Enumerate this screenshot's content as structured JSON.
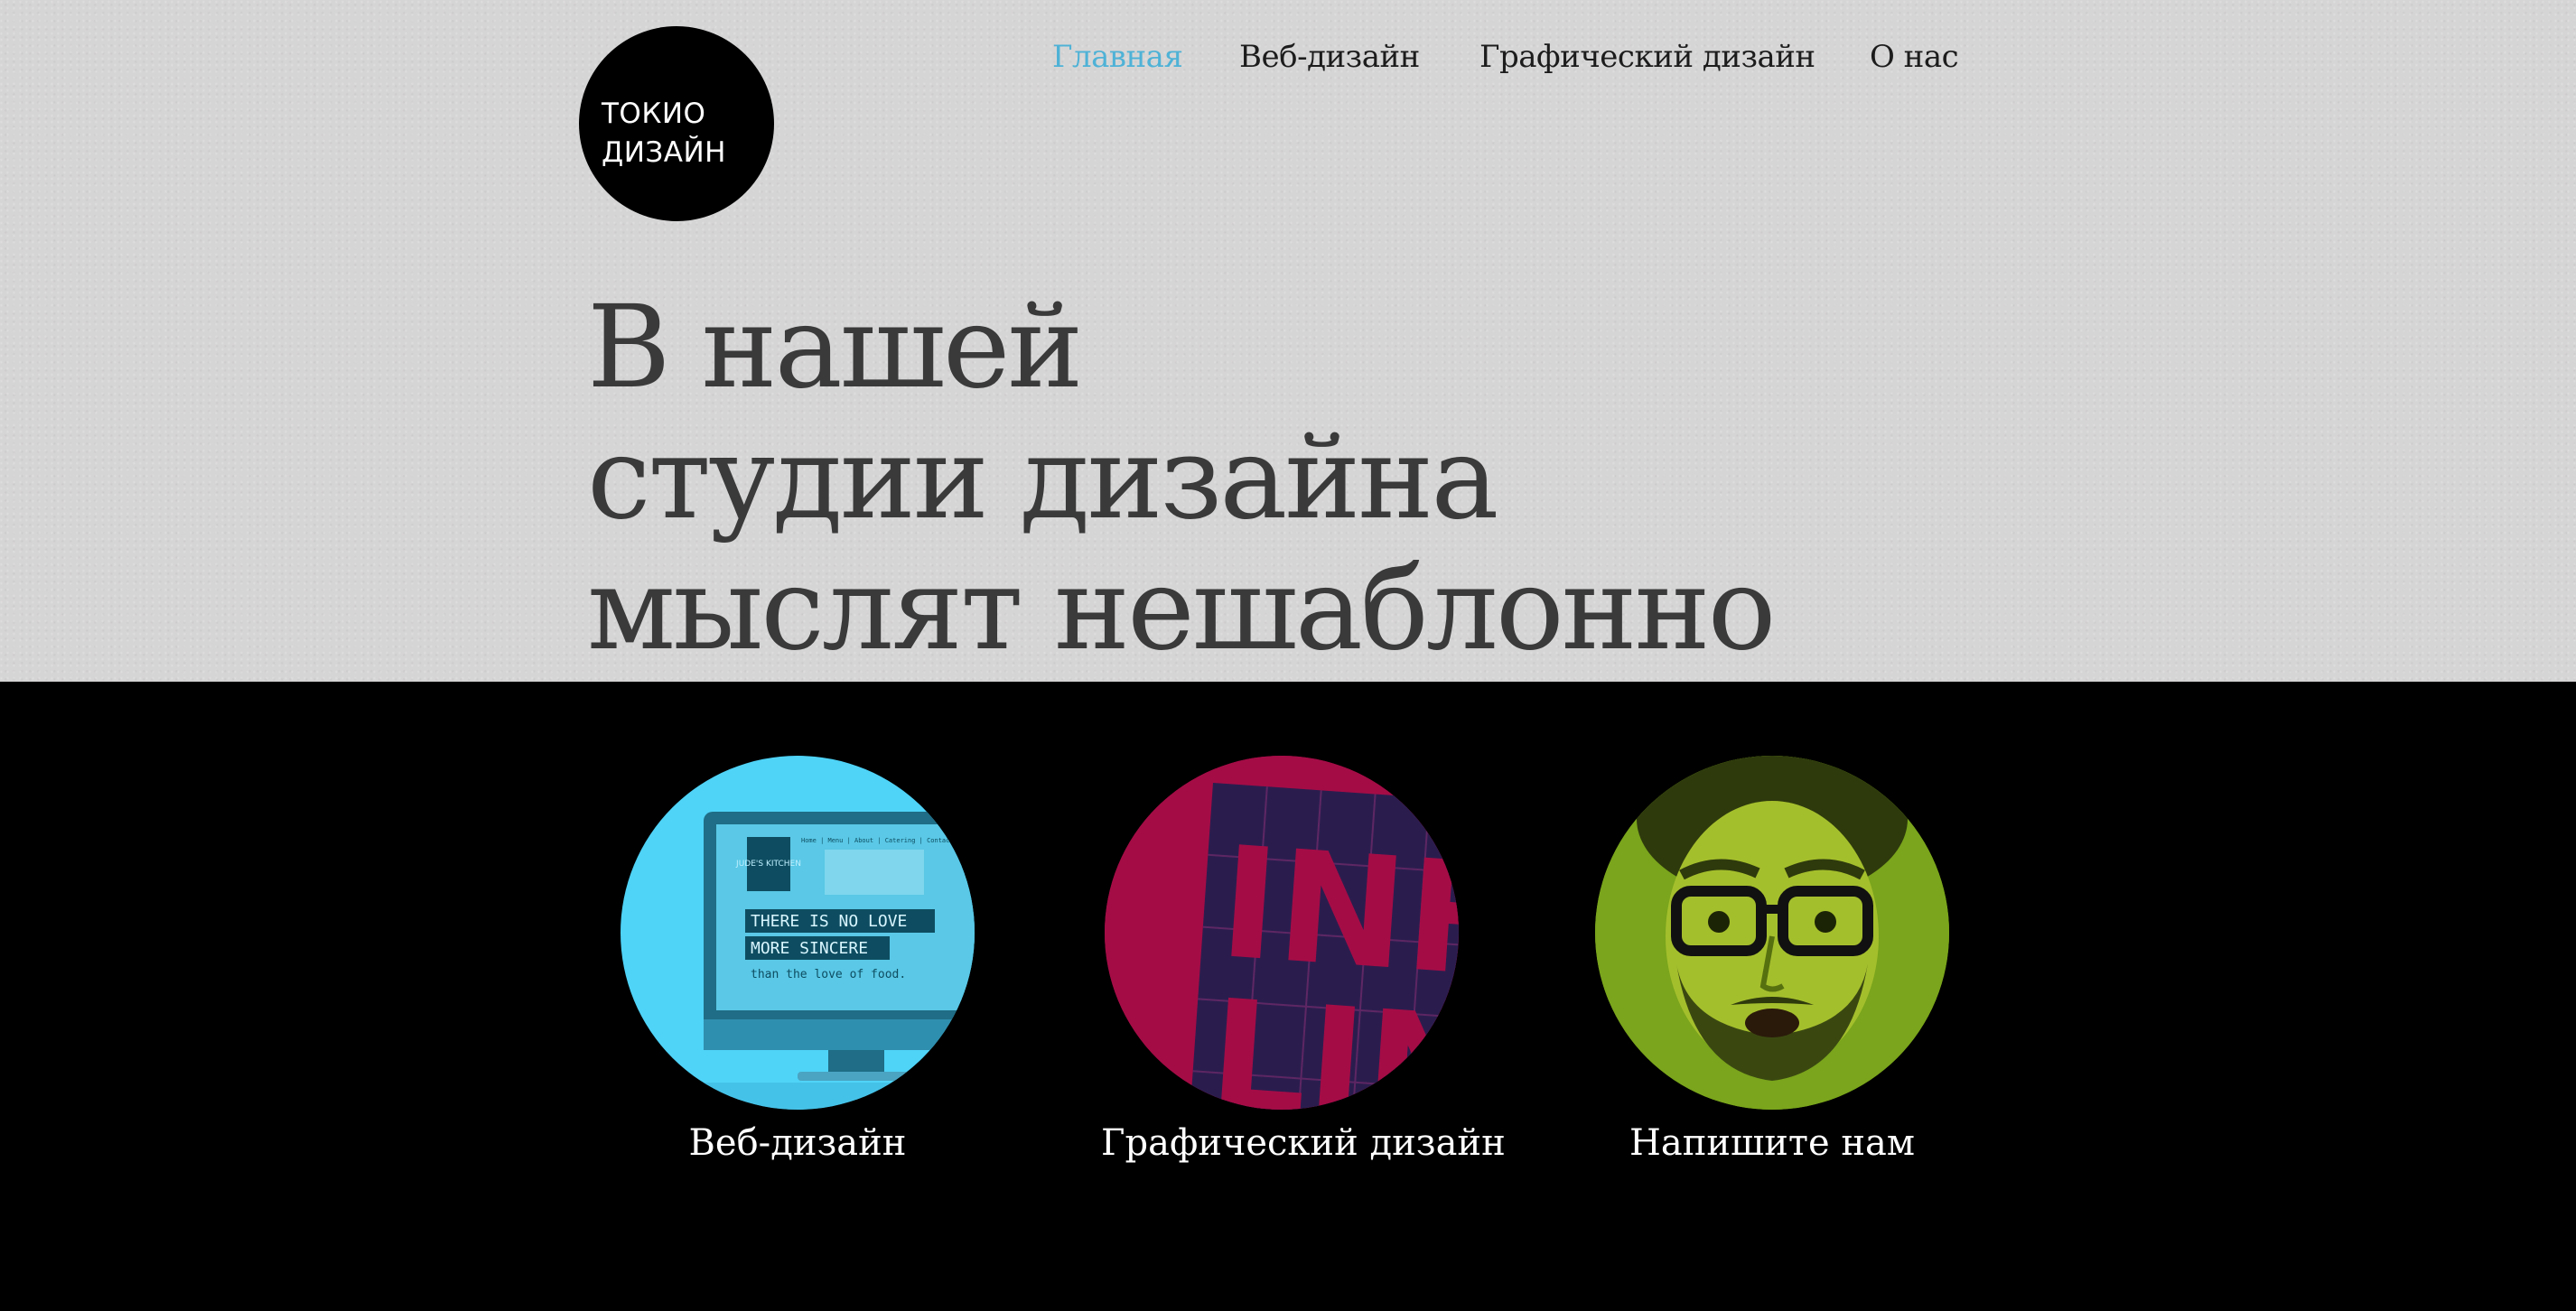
{
  "logo": {
    "line1": "ТОКИО",
    "line2": "ДИЗАЙН"
  },
  "nav": {
    "items": [
      {
        "label": "Главная",
        "active": true
      },
      {
        "label": "Веб-дизайн",
        "active": false
      },
      {
        "label": "Графический дизайн",
        "active": false
      },
      {
        "label": "О нас",
        "active": false
      }
    ]
  },
  "hero": {
    "headline_lines": [
      "В нашей",
      "студии дизайна",
      "мыслят нешаблонно"
    ]
  },
  "services": [
    {
      "label": "Веб-дизайн",
      "image": {
        "brand": "JUDE'S KITCHEN",
        "menu": "Home | Menu | About | Catering | Contact",
        "line1": "THERE IS NO LOVE",
        "line2": "MORE SINCERE",
        "line3": "than the love of food."
      }
    },
    {
      "label": "Графический дизайн",
      "image": {
        "word1": "INFO",
        "word2": "LINE"
      }
    },
    {
      "label": "Напишите нам"
    }
  ],
  "colors": {
    "accent": "#4fb2d6",
    "hero_bg": "#d6d5d5",
    "headline": "#3a3a3a",
    "web_circle": "#4fd3f7",
    "graphic_circle": "#a40c46",
    "contact_circle": "#7aa51c"
  }
}
